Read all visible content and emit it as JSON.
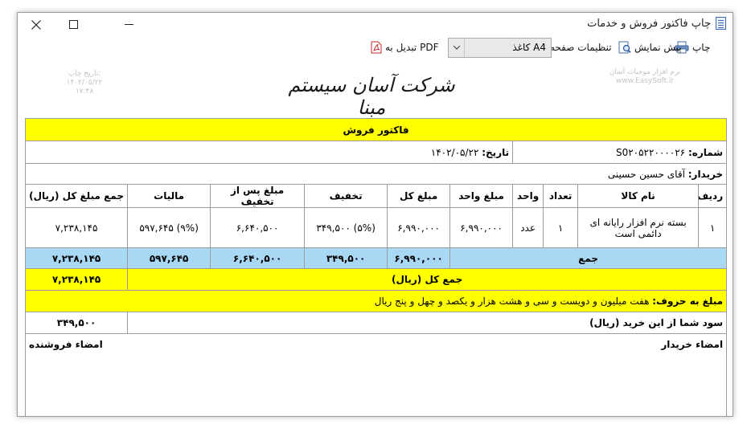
{
  "window": {
    "title": "چاپ فاکتور فروش و خدمات"
  },
  "toolbar": {
    "print_label": "چاپ",
    "preview_label": "پیش نمایش",
    "page_setup_label": "تنظیمات صفحه",
    "paper_select_value": "کاغذ A4",
    "pdf_label": "تبدیل به PDF"
  },
  "header": {
    "company_name": "شرکت آسان سیستم مبنا",
    "watermark_right_line1": "نرم افزار موجبات آسان",
    "watermark_right_line2": "www.EasySoft.ir",
    "print_date_label": "تاریخ چاپ:",
    "print_date": "۱۴۰۲/۰۵/۲۲",
    "print_time": "۱۷:۴۸"
  },
  "invoice": {
    "title": "فاکتور فروش",
    "number_label": "شماره:",
    "number_value": "S0۲۰۵۲۲۰۰۰۰۲۶",
    "date_label": "تاریخ:",
    "date_value": "۱۴۰۲/۰۵/۲۲",
    "buyer_label": "خریدار:",
    "buyer_value": "آقای حسین حسینی",
    "columns": [
      "ردیف",
      "نام کالا",
      "تعداد",
      "واحد",
      "مبلغ واحد",
      "مبلغ کل",
      "تخفیف",
      "مبلغ پس از تخفیف",
      "مالیات",
      "جمع مبلغ کل (ریال)"
    ],
    "rows": [
      {
        "row": "۱",
        "item": "بسته نرم افزار رایانه ای دائمی است",
        "qty": "۱",
        "unit": "عدد",
        "unit_price": "۶,۹۹۰,۰۰۰",
        "total": "۶,۹۹۰,۰۰۰",
        "discount": "(۵%) ۳۴۹,۵۰۰",
        "after_discount": "۶,۶۴۰,۵۰۰",
        "tax": "(۹%) ۵۹۷,۶۴۵",
        "grand": "۷,۲۳۸,۱۴۵"
      }
    ],
    "sum_label": "جمع",
    "sum_total": "۶,۹۹۰,۰۰۰",
    "sum_discount": "۳۴۹,۵۰۰",
    "sum_after_discount": "۶,۶۴۰,۵۰۰",
    "sum_tax": "۵۹۷,۶۴۵",
    "sum_grand": "۷,۲۳۸,۱۴۵",
    "grand_total_label": "جمع کل (ریال)",
    "grand_total_value": "۷,۲۳۸,۱۴۵",
    "in_words_label": "مبلغ به حروف:",
    "in_words_value": "هفت میلیون و دویست و سی و هشت هزار و یکصد و چهل و پنج ریال",
    "profit_label": "سود شما از این خرید (ریال)",
    "profit_value": "۳۴۹,۵۰۰",
    "buyer_signature_label": "امضاء خریدار",
    "seller_signature_label": "امضاء فروشنده"
  },
  "colors": {
    "highlight_yellow": "#ffff00",
    "summary_blue": "#a9d8f5"
  }
}
